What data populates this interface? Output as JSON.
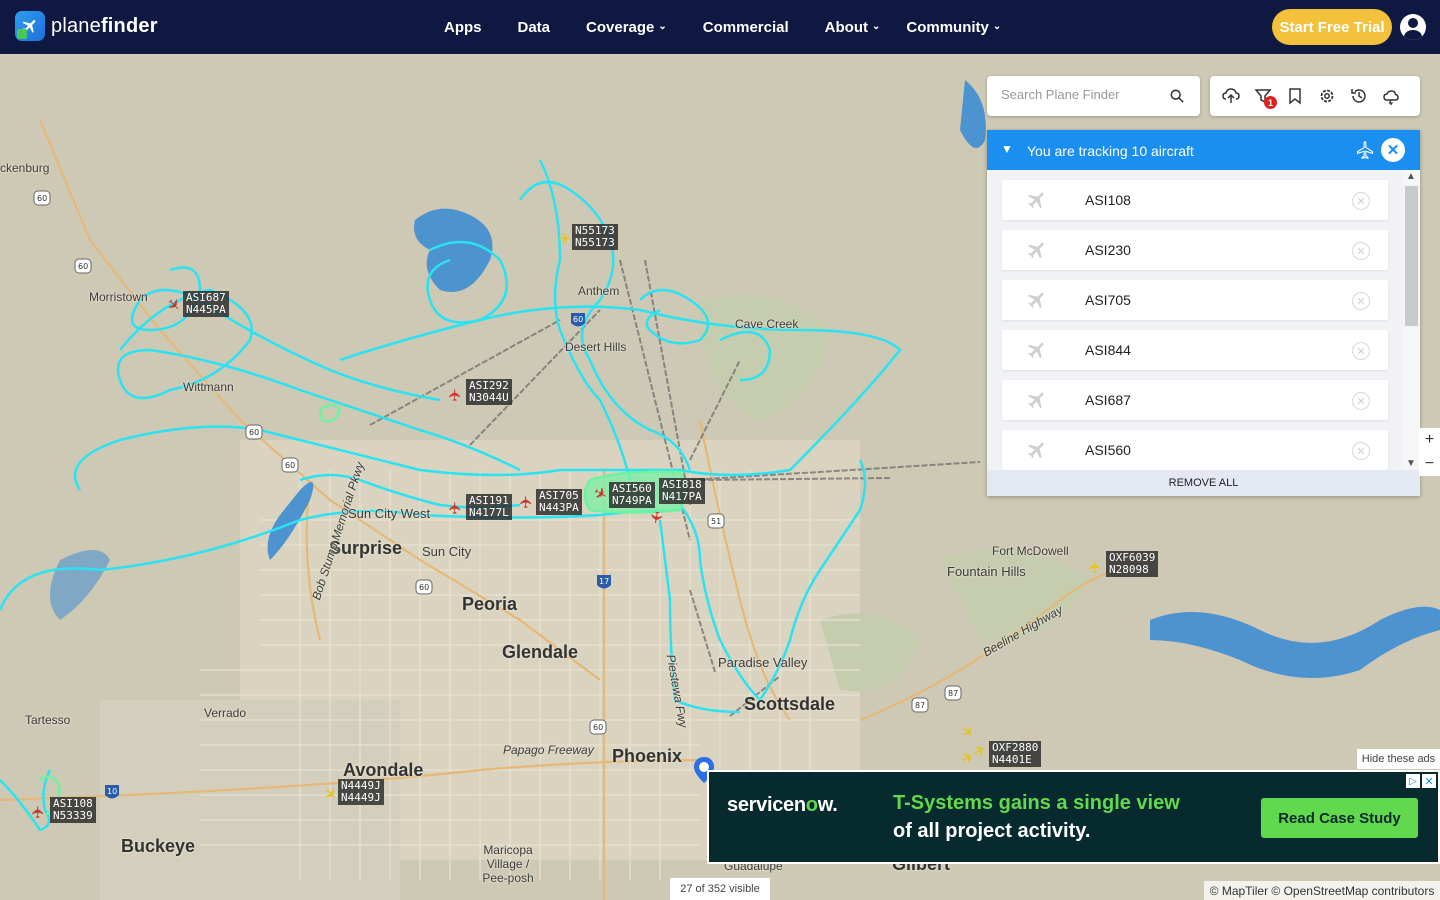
{
  "brand": {
    "name_light": "plane",
    "name_bold": "finder"
  },
  "nav": {
    "items": [
      {
        "label": "Apps",
        "dropdown": false
      },
      {
        "label": "Data",
        "dropdown": false
      },
      {
        "label": "Coverage",
        "dropdown": true
      },
      {
        "label": "Commercial",
        "dropdown": false
      },
      {
        "label": "About",
        "dropdown": true
      },
      {
        "label": "Community",
        "dropdown": true
      }
    ],
    "trial_button": "Start Free Trial"
  },
  "search": {
    "placeholder": "Search Plane Finder"
  },
  "toolbar": {
    "icons": [
      "cloud-upload-icon",
      "filter-icon",
      "bookmark-icon",
      "settings-icon",
      "history-icon",
      "weather-icon"
    ],
    "filter_badge": "1"
  },
  "tracking_panel": {
    "title": "You are tracking 10 aircraft",
    "aircraft": [
      "ASI108",
      "ASI230",
      "ASI705",
      "ASI844",
      "ASI687",
      "ASI560"
    ],
    "remove_all": "REMOVE ALL"
  },
  "map": {
    "places": [
      {
        "name": "ckenburg",
        "type": "small"
      },
      {
        "name": "Morristown",
        "type": "small"
      },
      {
        "name": "Wittmann",
        "type": "small"
      },
      {
        "name": "Anthem",
        "type": "small"
      },
      {
        "name": "Desert Hills",
        "type": "small"
      },
      {
        "name": "Cave Creek",
        "type": "small"
      },
      {
        "name": "Sun City West",
        "type": "mid"
      },
      {
        "name": "Surprise",
        "type": "city"
      },
      {
        "name": "Sun City",
        "type": "mid"
      },
      {
        "name": "Peoria",
        "type": "city"
      },
      {
        "name": "Glendale",
        "type": "city"
      },
      {
        "name": "Fort McDowell",
        "type": "small"
      },
      {
        "name": "Fountain Hills",
        "type": "mid"
      },
      {
        "name": "Paradise Valley",
        "type": "mid"
      },
      {
        "name": "Scottsdale",
        "type": "city"
      },
      {
        "name": "Tartesso",
        "type": "small"
      },
      {
        "name": "Verrado",
        "type": "small"
      },
      {
        "name": "Avondale",
        "type": "city"
      },
      {
        "name": "Phoenix",
        "type": "city"
      },
      {
        "name": "Buckeye",
        "type": "city"
      },
      {
        "name": "Maricopa Village / Pee-posh",
        "type": "small"
      },
      {
        "name": "Guadalupe",
        "type": "small"
      },
      {
        "name": "Gilbert",
        "type": "city"
      },
      {
        "name": "Papago Freeway",
        "type": "small"
      },
      {
        "name": "Beeline Highway",
        "type": "small"
      },
      {
        "name": "Bob Stump Memorial Pkwy",
        "type": "small"
      },
      {
        "name": "Piestewa Fwy",
        "type": "small"
      }
    ],
    "route_shields": [
      "60",
      "60",
      "60",
      "60",
      "60",
      "51",
      "17",
      "60",
      "87",
      "87",
      "10",
      "60"
    ],
    "aircraft_labels": [
      {
        "callsign": "N55173",
        "reg": "N55173",
        "color": "yellow"
      },
      {
        "callsign": "ASI687",
        "reg": "N445PA",
        "color": "red"
      },
      {
        "callsign": "ASI292",
        "reg": "N3044U",
        "color": "red"
      },
      {
        "callsign": "ASI191",
        "reg": "N4177L",
        "color": "red"
      },
      {
        "callsign": "ASI705",
        "reg": "N443PA",
        "color": "red"
      },
      {
        "callsign": "ASI560",
        "reg": "N749PA",
        "color": "red"
      },
      {
        "callsign": "ASI818",
        "reg": "N417PA",
        "color": "red"
      },
      {
        "callsign": "OXF6039",
        "reg": "N28098",
        "color": "yellow"
      },
      {
        "callsign": "OXF2880",
        "reg": "N4401E",
        "color": "yellow"
      },
      {
        "callsign": "N4449J",
        "reg": "N4449J",
        "color": "yellow"
      },
      {
        "callsign": "ASI108",
        "reg": "N53339",
        "color": "red"
      }
    ],
    "visible_count": "27 of 352 visible",
    "attribution": "© MapTiler © OpenStreetMap contributors",
    "zoom_in": "+",
    "zoom_out": "−"
  },
  "ad": {
    "hide_label": "Hide these ads",
    "brand_a": "servicen",
    "brand_b": "o",
    "brand_c": "w.",
    "headline": "T-Systems gains a single view",
    "subline": "of all project activity.",
    "cta": "Read Case Study",
    "colors": {
      "bg": "#062a2e",
      "accent": "#62d84e"
    }
  },
  "colors": {
    "nav_bg": "#0f1840",
    "trial": "#f4c13c",
    "panel_head": "#1a8fef",
    "track": "#2ee6f5"
  }
}
